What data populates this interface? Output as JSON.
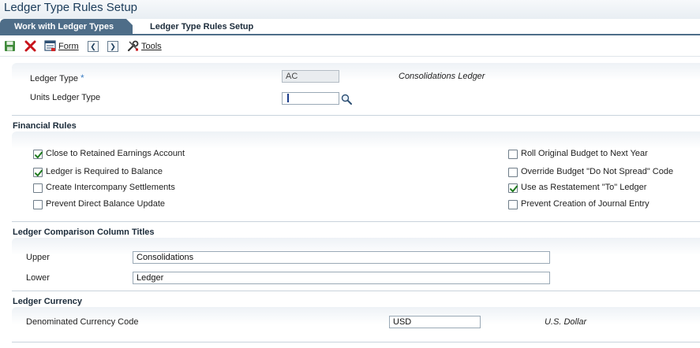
{
  "app": {
    "title": "Ledger Type Rules Setup"
  },
  "tabs": [
    {
      "label": "Work with Ledger Types"
    },
    {
      "label": "Ledger Type Rules Setup"
    }
  ],
  "toolbar": {
    "save_icon": "save-icon",
    "close_icon": "close-icon",
    "form_label": "Form",
    "prev_icon": "prev-record-icon",
    "next_icon": "next-record-icon",
    "tools_label": "Tools"
  },
  "header": {
    "ledger_type_label": "Ledger Type",
    "required_mark": "*",
    "ledger_type_value": "AC",
    "ledger_type_desc": "Consolidations Ledger",
    "units_ledger_label": "Units Ledger Type",
    "units_ledger_value": ""
  },
  "financial_rules": {
    "title": "Financial Rules",
    "left": [
      {
        "label": "Close to Retained Earnings Account",
        "checked": true
      },
      {
        "label": "Ledger is Required to Balance",
        "checked": true
      },
      {
        "label": "Create Intercompany Settlements",
        "checked": false
      },
      {
        "label": "Prevent Direct Balance Update",
        "checked": false
      }
    ],
    "right": [
      {
        "label": "Roll Original Budget to Next Year",
        "checked": false
      },
      {
        "label": "Override Budget \"Do Not Spread\" Code",
        "checked": false
      },
      {
        "label": "Use as Restatement \"To\" Ledger",
        "checked": true
      },
      {
        "label": "Prevent Creation of Journal Entry",
        "checked": false
      }
    ]
  },
  "comparison": {
    "title": "Ledger Comparison Column Titles",
    "upper_label": "Upper",
    "upper_value": "Consolidations",
    "lower_label": "Lower",
    "lower_value": "Ledger"
  },
  "currency": {
    "title": "Ledger Currency",
    "code_label": "Denominated Currency Code",
    "code_value": "USD",
    "code_desc": "U.S. Dollar"
  },
  "colors": {
    "tab_active_bg": "#4e6d88",
    "accent": "#3f7fc4"
  }
}
